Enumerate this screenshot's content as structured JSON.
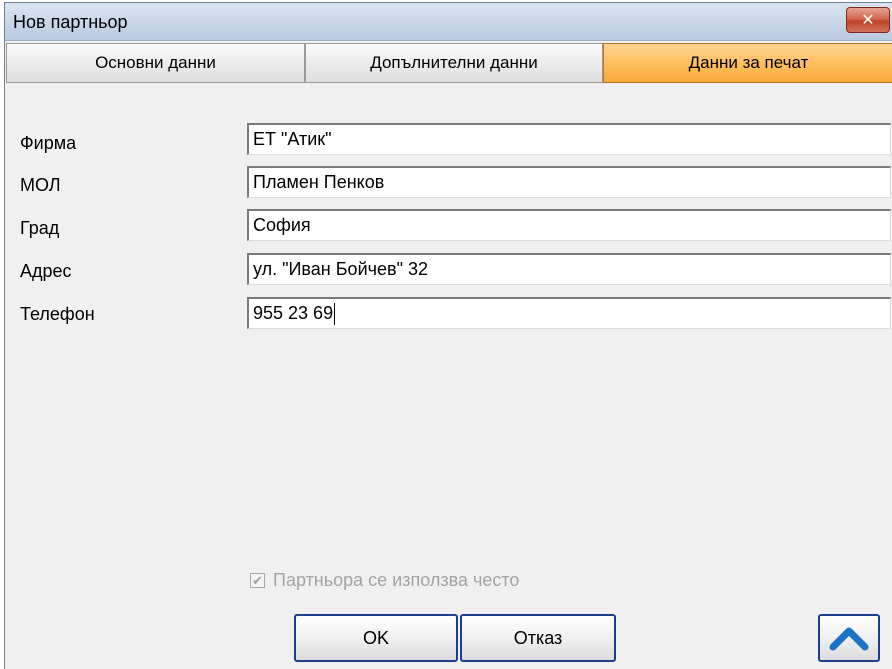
{
  "window": {
    "title": "Нов партньор",
    "close_glyph": "✕"
  },
  "tabs": [
    {
      "label": "Основни данни"
    },
    {
      "label": "Допълнителни данни"
    },
    {
      "label": "Данни за печат"
    }
  ],
  "fields": [
    {
      "label": "Фирма",
      "value": "ЕТ \"Атик\""
    },
    {
      "label": "МОЛ",
      "value": "Пламен Пенков"
    },
    {
      "label": "Град",
      "value": "София"
    },
    {
      "label": "Адрес",
      "value": "ул. \"Иван Бойчев\" 32"
    },
    {
      "label": "Телефон",
      "value": "955 23 69"
    }
  ],
  "checkbox": {
    "label": "Партньора се използва често",
    "checked": true,
    "disabled": true
  },
  "buttons": {
    "ok": "OK",
    "cancel": "Отказ"
  },
  "colors": {
    "active_tab": "#ffc060",
    "accent_border": "#1b3f8f",
    "up_arrow": "#1a73c9"
  }
}
